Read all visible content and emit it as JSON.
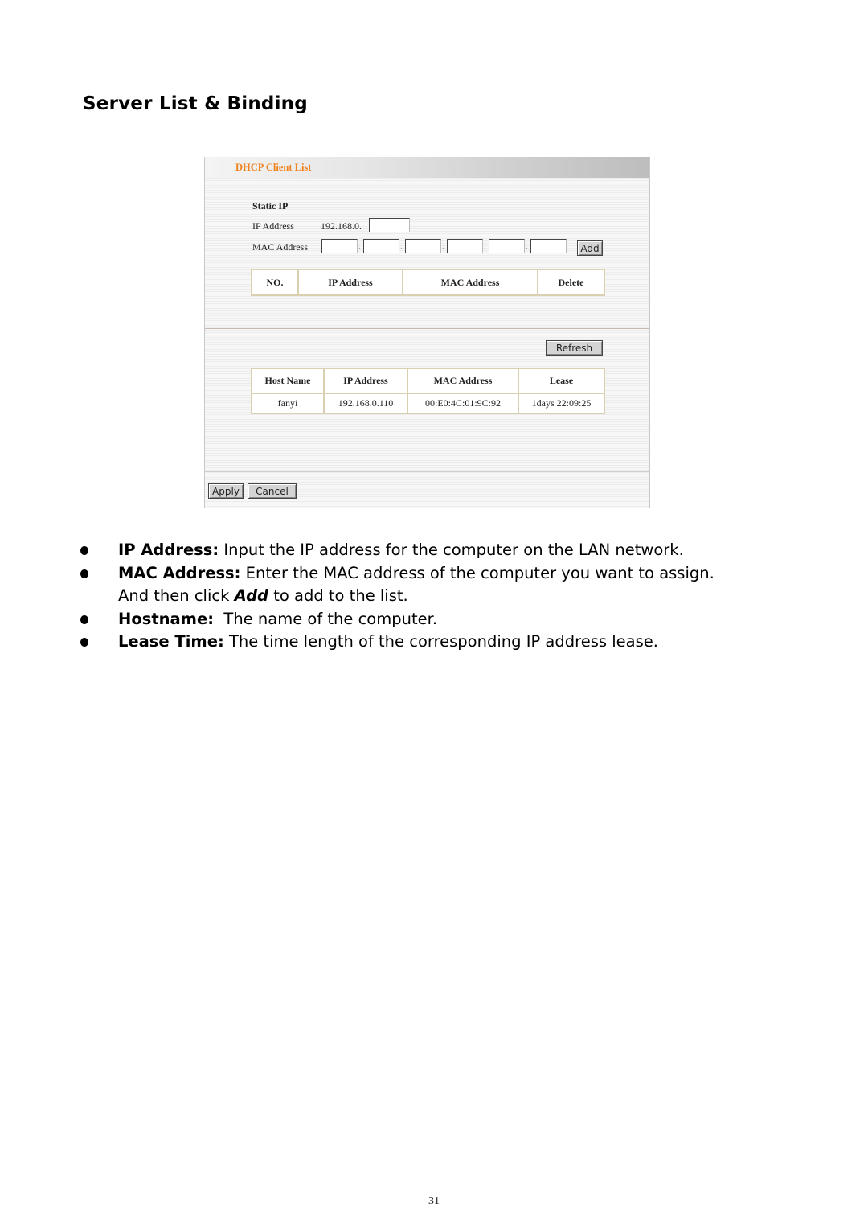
{
  "section_title": "Server List & Binding",
  "screenshot": {
    "header_title": "DHCP Client List",
    "static_ip": {
      "heading": "Static IP",
      "ip_label": "IP Address",
      "ip_prefix": "192.168.0.",
      "ip_last_octet": "",
      "mac_label": "MAC Address",
      "mac_octets": [
        "",
        "",
        "",
        "",
        "",
        ""
      ],
      "mac_separator": ":",
      "add_button": "Add"
    },
    "binding_table": {
      "headers": [
        "NO.",
        "IP Address",
        "MAC Address",
        "Delete"
      ],
      "rows": []
    },
    "refresh_button": "Refresh",
    "client_table": {
      "headers": [
        "Host Name",
        "IP Address",
        "MAC Address",
        "Lease"
      ],
      "rows": [
        [
          "fanyi",
          "192.168.0.110",
          "00:E0:4C:01:9C:92",
          "1days 22:09:25"
        ]
      ]
    },
    "apply_button": "Apply",
    "cancel_button": "Cancel"
  },
  "bullets": [
    {
      "term": "IP Address:",
      "text": " Input the IP address for the computer on the LAN network."
    },
    {
      "term": "MAC Address:",
      "text": " Enter the MAC address of the computer you want to assign.",
      "cont_pre": "And then click ",
      "cont_em": "Add",
      "cont_post": " to add to the list."
    },
    {
      "term": "Hostname:",
      "text": "  The name of the computer."
    },
    {
      "term": "Lease Time:",
      "text": " The time length of the corresponding IP address lease."
    }
  ],
  "page_number": "31"
}
